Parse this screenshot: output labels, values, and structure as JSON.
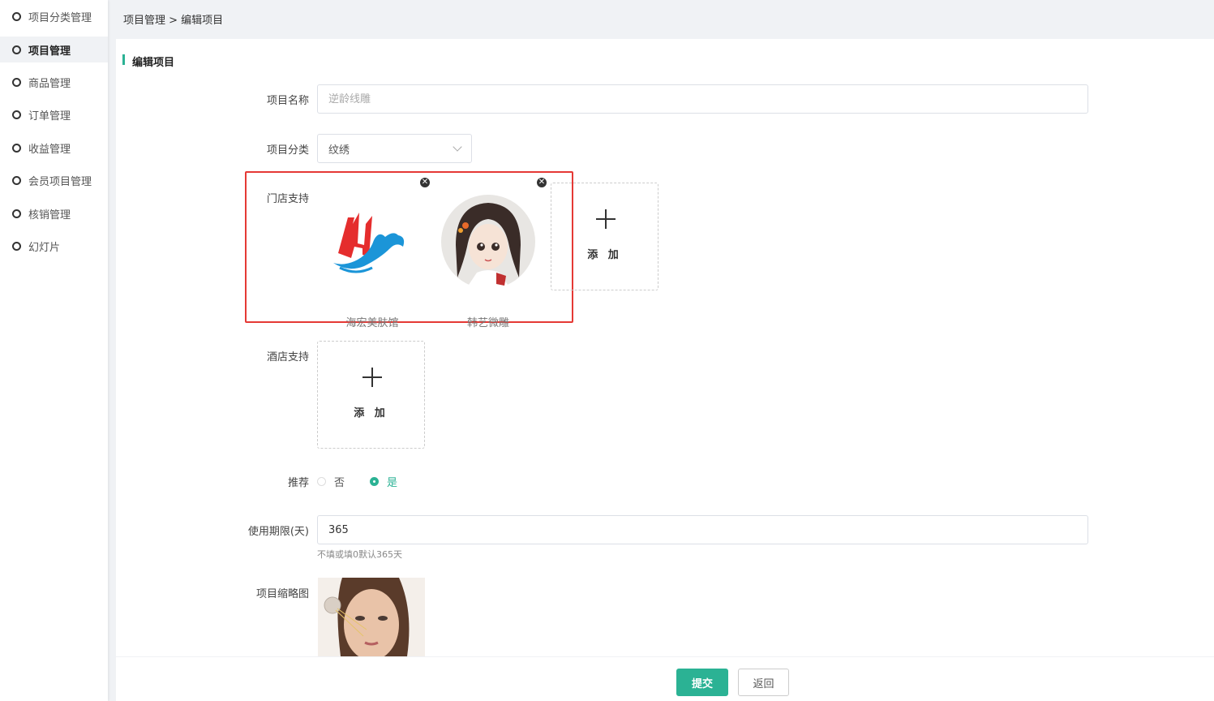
{
  "sidebar": {
    "items": [
      {
        "label": "项目分类管理"
      },
      {
        "label": "项目管理"
      },
      {
        "label": "商品管理"
      },
      {
        "label": "订单管理"
      },
      {
        "label": "收益管理"
      },
      {
        "label": "会员项目管理"
      },
      {
        "label": "核销管理"
      },
      {
        "label": "幻灯片"
      }
    ]
  },
  "breadcrumb": "项目管理 > 编辑项目",
  "section_title": "编辑项目",
  "form": {
    "name_label": "项目名称",
    "name_placeholder": "逆龄线雕",
    "category_label": "项目分类",
    "category_value": "纹绣",
    "stores_label": "门店支持",
    "stores": [
      {
        "name": "海宏美肤馆"
      },
      {
        "name": "韩艺微雕"
      }
    ],
    "add_label": "添 加",
    "hotels_label": "酒店支持",
    "recommend_label": "推荐",
    "recommend_options": {
      "no": "否",
      "yes": "是"
    },
    "validity_label": "使用期限(天)",
    "validity_value": "365",
    "validity_hint": "不填或填0默认365天",
    "thumb_label": "项目缩略图"
  },
  "buttons": {
    "submit": "提交",
    "back": "返回"
  },
  "colors": {
    "accent": "#2bb294",
    "highlight": "#e53935"
  }
}
